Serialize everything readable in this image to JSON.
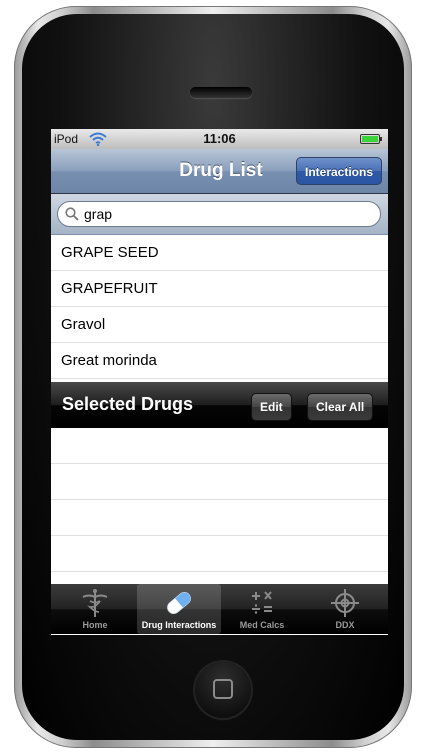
{
  "status": {
    "carrier": "iPod",
    "time": "11:06"
  },
  "nav": {
    "title": "Drug List",
    "button_label": "Interactions"
  },
  "search": {
    "value": "grap",
    "placeholder": ""
  },
  "results": [
    {
      "label": "GRAPE SEED"
    },
    {
      "label": "GRAPEFRUIT"
    },
    {
      "label": "Gravol"
    },
    {
      "label": "Great morinda"
    }
  ],
  "selected_section": {
    "title": "Selected Drugs",
    "edit_label": "Edit",
    "clear_label": "Clear All"
  },
  "tabs": [
    {
      "label": "Home",
      "icon": "caduceus-icon",
      "selected": false
    },
    {
      "label": "Drug Interactions",
      "icon": "pill-icon",
      "selected": true
    },
    {
      "label": "Med Calcs",
      "icon": "calculator-icon",
      "selected": false
    },
    {
      "label": "DDX",
      "icon": "crosshair-icon",
      "selected": false
    }
  ],
  "colors": {
    "nav_bar": "#7890b0",
    "nav_button": "#2f5aa8",
    "battery": "#3bd23b"
  }
}
